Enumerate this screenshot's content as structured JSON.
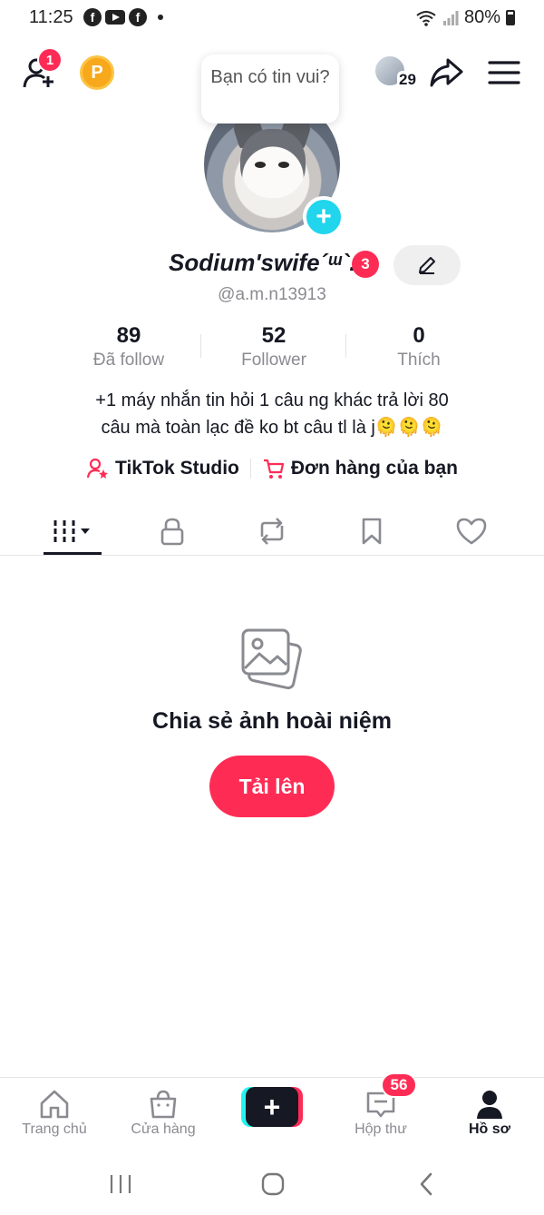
{
  "status_bar": {
    "time": "11:25",
    "battery": "80%",
    "notification_icons": [
      "facebook-icon",
      "youtube-icon",
      "facebook-icon"
    ]
  },
  "top_bar": {
    "friend_requests_badge": "1",
    "coin_label": "P",
    "visitors_count": "29",
    "tooltip": "Bạn có tin vui?"
  },
  "profile": {
    "display_name": "Sodium'swife´ᵚ`.",
    "name_badge": "3",
    "username": "@a.m.n13913",
    "stats": [
      {
        "value": "89",
        "label": "Đã follow"
      },
      {
        "value": "52",
        "label": "Follower"
      },
      {
        "value": "0",
        "label": "Thích"
      }
    ],
    "bio_line1": "+1 máy nhắn tin hỏi 1 câu ng khác trả lời 80",
    "bio_line2": "câu mà toàn lạc đề ko bt câu tl là j🫠🫠🫠",
    "links": [
      {
        "label": "TikTok Studio",
        "icon": "studio-icon"
      },
      {
        "label": "Đơn hàng của bạn",
        "icon": "cart-icon"
      }
    ]
  },
  "tabs": [
    "videos-grid-icon",
    "lock-icon",
    "repost-icon",
    "bookmark-icon",
    "heart-icon"
  ],
  "empty_state": {
    "title": "Chia sẻ ảnh hoài niệm",
    "button": "Tải lên"
  },
  "bottom_nav": {
    "home": "Trang chủ",
    "shop": "Cửa hàng",
    "inbox": "Hộp thư",
    "inbox_badge": "56",
    "profile": "Hồ sơ"
  },
  "colors": {
    "accent": "#fe2c55",
    "cyan": "#20d5ec",
    "text": "#161823",
    "muted": "#8a8b91"
  }
}
